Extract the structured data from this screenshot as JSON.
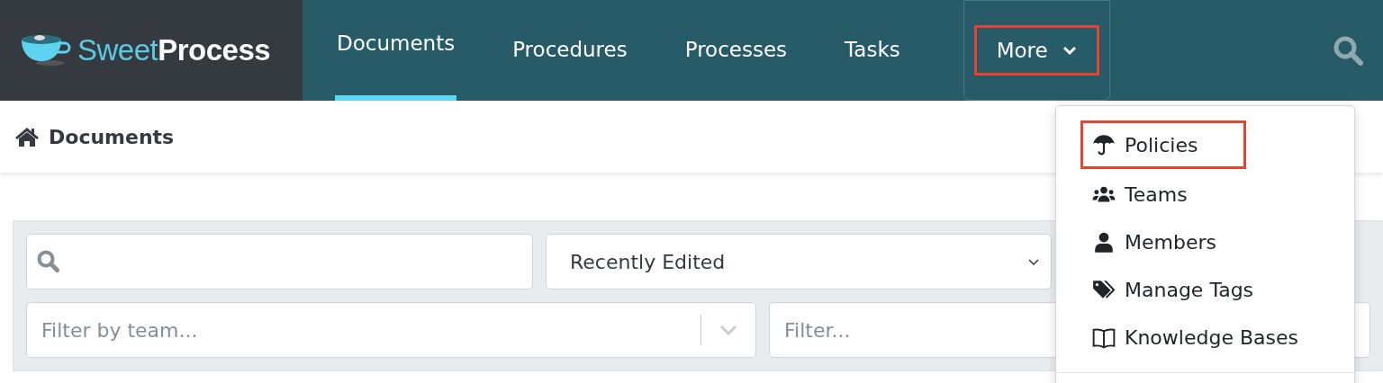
{
  "logo": {
    "light": "Sweet",
    "bold": "Process"
  },
  "nav": [
    {
      "label": "Documents",
      "selected": true,
      "highlighted": false,
      "kind": "tab"
    },
    {
      "label": "Procedures",
      "selected": false,
      "highlighted": false,
      "kind": "tab"
    },
    {
      "label": "Processes",
      "selected": false,
      "highlighted": false,
      "kind": "tab"
    },
    {
      "label": "Tasks",
      "selected": false,
      "highlighted": false,
      "kind": "tab"
    },
    {
      "label": "More",
      "selected": false,
      "highlighted": true,
      "kind": "dropdown"
    }
  ],
  "page_title": "Documents",
  "filters": {
    "sort": "Recently Edited",
    "team_placeholder": "Filter by team...",
    "filter_placeholder": "Filter..."
  },
  "menu": [
    {
      "label": "Policies",
      "kind": "umbrella",
      "highlighted": true
    },
    {
      "label": "Teams",
      "kind": "users",
      "highlighted": false
    },
    {
      "label": "Members",
      "kind": "user",
      "highlighted": false
    },
    {
      "label": "Manage Tags",
      "kind": "tags",
      "highlighted": false
    },
    {
      "label": "Knowledge Bases",
      "kind": "book",
      "highlighted": false
    }
  ]
}
